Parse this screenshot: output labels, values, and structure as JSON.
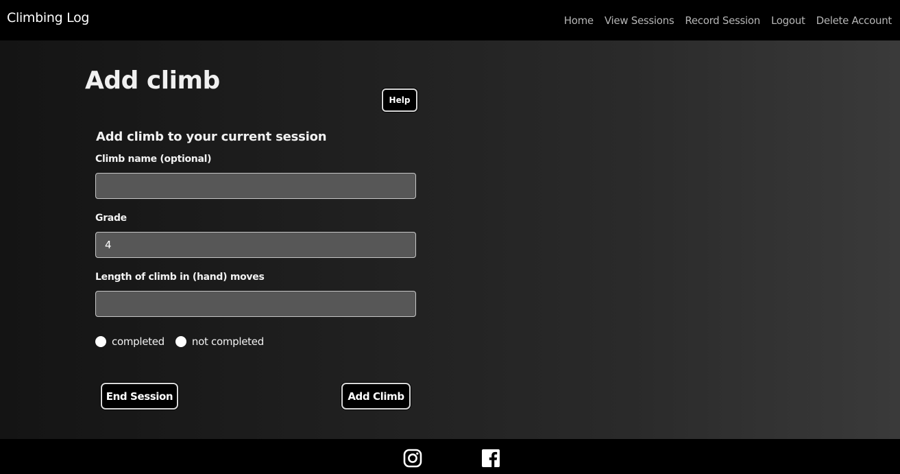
{
  "navbar": {
    "brand": "Climbing Log",
    "links": [
      "Home",
      "View Sessions",
      "Record Session",
      "Logout",
      "Delete Account"
    ]
  },
  "page": {
    "title": "Add climb",
    "help_label": "Help"
  },
  "form": {
    "heading": "Add climb to your current session",
    "name_label": "Climb name (optional)",
    "name_value": "",
    "grade_label": "Grade",
    "grade_value": "4",
    "length_label": "Length of climb in (hand) moves",
    "length_value": "",
    "radio_completed": "completed",
    "radio_not_completed": "not completed",
    "end_session_label": "End Session",
    "add_climb_label": "Add Climb"
  },
  "footer": {
    "icons": [
      "instagram-icon",
      "facebook-icon"
    ]
  },
  "colors": {
    "navbar_bg": "#000000",
    "nav_link": "#b5b5b5",
    "input_bg": "#575757",
    "button_bg": "#000000"
  }
}
